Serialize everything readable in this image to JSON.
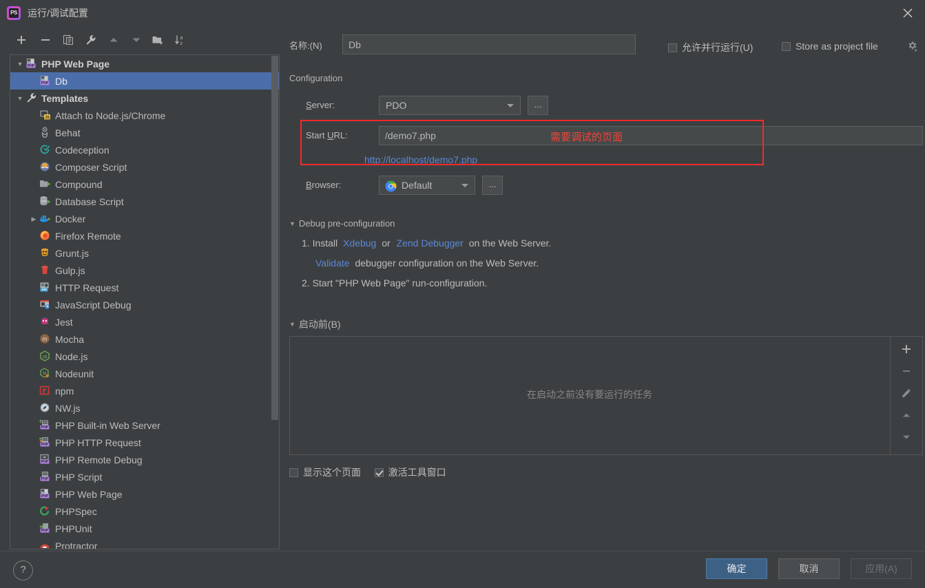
{
  "window": {
    "title": "运行/调试配置",
    "app_icon": "phpstorm-icon",
    "close_icon": "close-icon"
  },
  "left_toolbar": {
    "items": [
      {
        "name": "add-configuration-button",
        "icon": "plus-icon"
      },
      {
        "name": "remove-configuration-button",
        "icon": "minus-icon"
      },
      {
        "name": "copy-configuration-button",
        "icon": "copy-icon"
      },
      {
        "name": "edit-templates-button",
        "icon": "wrench-icon"
      },
      {
        "name": "move-up-button",
        "icon": "arrow-up-icon"
      },
      {
        "name": "move-down-button",
        "icon": "arrow-down-icon"
      },
      {
        "name": "new-folder-button",
        "icon": "folder-add-icon"
      },
      {
        "name": "sort-configurations-button",
        "icon": "sort-az-icon"
      }
    ]
  },
  "tree": {
    "rows": [
      {
        "label": "PHP Web Page",
        "icon": "php-web-page-icon",
        "level": 0,
        "twisty": "down",
        "group": true,
        "selected": false
      },
      {
        "label": "Db",
        "icon": "php-web-page-icon",
        "level": 1,
        "twisty": "none",
        "group": false,
        "selected": true
      },
      {
        "label": "Templates",
        "icon": "wrench-icon",
        "level": 0,
        "twisty": "down",
        "group": true,
        "selected": false
      },
      {
        "label": "Attach to Node.js/Chrome",
        "icon": "attach-nodejs-icon",
        "level": 1,
        "twisty": "none",
        "group": false,
        "selected": false
      },
      {
        "label": "Behat",
        "icon": "behat-icon",
        "level": 1,
        "twisty": "none",
        "group": false,
        "selected": false
      },
      {
        "label": "Codeception",
        "icon": "codeception-icon",
        "level": 1,
        "twisty": "none",
        "group": false,
        "selected": false
      },
      {
        "label": "Composer Script",
        "icon": "composer-icon",
        "level": 1,
        "twisty": "none",
        "group": false,
        "selected": false
      },
      {
        "label": "Compound",
        "icon": "compound-icon",
        "level": 1,
        "twisty": "none",
        "group": false,
        "selected": false
      },
      {
        "label": "Database Script",
        "icon": "database-script-icon",
        "level": 1,
        "twisty": "none",
        "group": false,
        "selected": false
      },
      {
        "label": "Docker",
        "icon": "docker-icon",
        "level": 1,
        "twisty": "right",
        "group": false,
        "selected": false
      },
      {
        "label": "Firefox Remote",
        "icon": "firefox-icon",
        "level": 1,
        "twisty": "none",
        "group": false,
        "selected": false
      },
      {
        "label": "Grunt.js",
        "icon": "grunt-icon",
        "level": 1,
        "twisty": "none",
        "group": false,
        "selected": false
      },
      {
        "label": "Gulp.js",
        "icon": "gulp-icon",
        "level": 1,
        "twisty": "none",
        "group": false,
        "selected": false
      },
      {
        "label": "HTTP Request",
        "icon": "http-request-icon",
        "level": 1,
        "twisty": "none",
        "group": false,
        "selected": false
      },
      {
        "label": "JavaScript Debug",
        "icon": "javascript-debug-icon",
        "level": 1,
        "twisty": "none",
        "group": false,
        "selected": false
      },
      {
        "label": "Jest",
        "icon": "jest-icon",
        "level": 1,
        "twisty": "none",
        "group": false,
        "selected": false
      },
      {
        "label": "Mocha",
        "icon": "mocha-icon",
        "level": 1,
        "twisty": "none",
        "group": false,
        "selected": false
      },
      {
        "label": "Node.js",
        "icon": "nodejs-icon",
        "level": 1,
        "twisty": "none",
        "group": false,
        "selected": false
      },
      {
        "label": "Nodeunit",
        "icon": "nodeunit-icon",
        "level": 1,
        "twisty": "none",
        "group": false,
        "selected": false
      },
      {
        "label": "npm",
        "icon": "npm-icon",
        "level": 1,
        "twisty": "none",
        "group": false,
        "selected": false
      },
      {
        "label": "NW.js",
        "icon": "nwjs-icon",
        "level": 1,
        "twisty": "none",
        "group": false,
        "selected": false
      },
      {
        "label": "PHP Built-in Web Server",
        "icon": "php-builtin-server-icon",
        "level": 1,
        "twisty": "none",
        "group": false,
        "selected": false
      },
      {
        "label": "PHP HTTP Request",
        "icon": "php-http-request-icon",
        "level": 1,
        "twisty": "none",
        "group": false,
        "selected": false
      },
      {
        "label": "PHP Remote Debug",
        "icon": "php-remote-debug-icon",
        "level": 1,
        "twisty": "none",
        "group": false,
        "selected": false
      },
      {
        "label": "PHP Script",
        "icon": "php-script-icon",
        "level": 1,
        "twisty": "none",
        "group": false,
        "selected": false
      },
      {
        "label": "PHP Web Page",
        "icon": "php-web-page-icon",
        "level": 1,
        "twisty": "none",
        "group": false,
        "selected": false
      },
      {
        "label": "PHPSpec",
        "icon": "phpspec-icon",
        "level": 1,
        "twisty": "none",
        "group": false,
        "selected": false
      },
      {
        "label": "PHPUnit",
        "icon": "phpunit-icon",
        "level": 1,
        "twisty": "none",
        "group": false,
        "selected": false
      },
      {
        "label": "Protractor",
        "icon": "protractor-icon",
        "level": 1,
        "twisty": "none",
        "group": false,
        "selected": false
      }
    ]
  },
  "form": {
    "name_label": "名称:(N)",
    "name_value": "Db",
    "allow_parallel_label": "允许并行运行(U)",
    "allow_parallel_checked": false,
    "store_as_project_file_label": "Store as project file",
    "store_as_project_file_checked": false,
    "gear_icon": "gear-dropdown-icon",
    "configuration_section": "Configuration",
    "server_label": "Server:",
    "server_value": "PDO",
    "server_browse": "...",
    "start_url_label": "Start URL:",
    "start_url_value": "/demo7.php",
    "resolved_url": "http://localhost/demo7.php",
    "annotation": "需要调试的页面",
    "annotation_color": "#f44336",
    "browser_label": "Browser:",
    "browser_value": "Default",
    "browser_icon": "chrome-icon",
    "browser_browse": "..."
  },
  "debug_section": {
    "title": "Debug pre-configuration",
    "step1_prefix": "1. Install",
    "xdebug_link": "Xdebug",
    "step1_or": "or",
    "zend_link": "Zend Debugger",
    "step1_suffix": "on the Web Server.",
    "validate_link": "Validate",
    "validate_suffix": "debugger configuration on the Web Server.",
    "step2": "2. Start \"PHP Web Page\" run-configuration."
  },
  "before_launch": {
    "title": "启动前(B)",
    "empty_text": "在启动之前没有要运行的任务",
    "buttons": [
      {
        "name": "add-task-button",
        "icon": "plus-icon"
      },
      {
        "name": "remove-task-button",
        "icon": "minus-icon"
      },
      {
        "name": "edit-task-button",
        "icon": "pencil-icon"
      },
      {
        "name": "move-task-up-button",
        "icon": "arrow-up-icon"
      },
      {
        "name": "move-task-down-button",
        "icon": "arrow-down-icon"
      }
    ],
    "show_page_label": "显示这个页面",
    "show_page_checked": false,
    "activate_toolwindow_label": "激活工具窗口",
    "activate_toolwindow_checked": true
  },
  "footer": {
    "help_icon": "help-icon",
    "ok_label": "确定",
    "cancel_label": "取消",
    "apply_label": "应用(A)",
    "primary_color": "#3d6185"
  }
}
